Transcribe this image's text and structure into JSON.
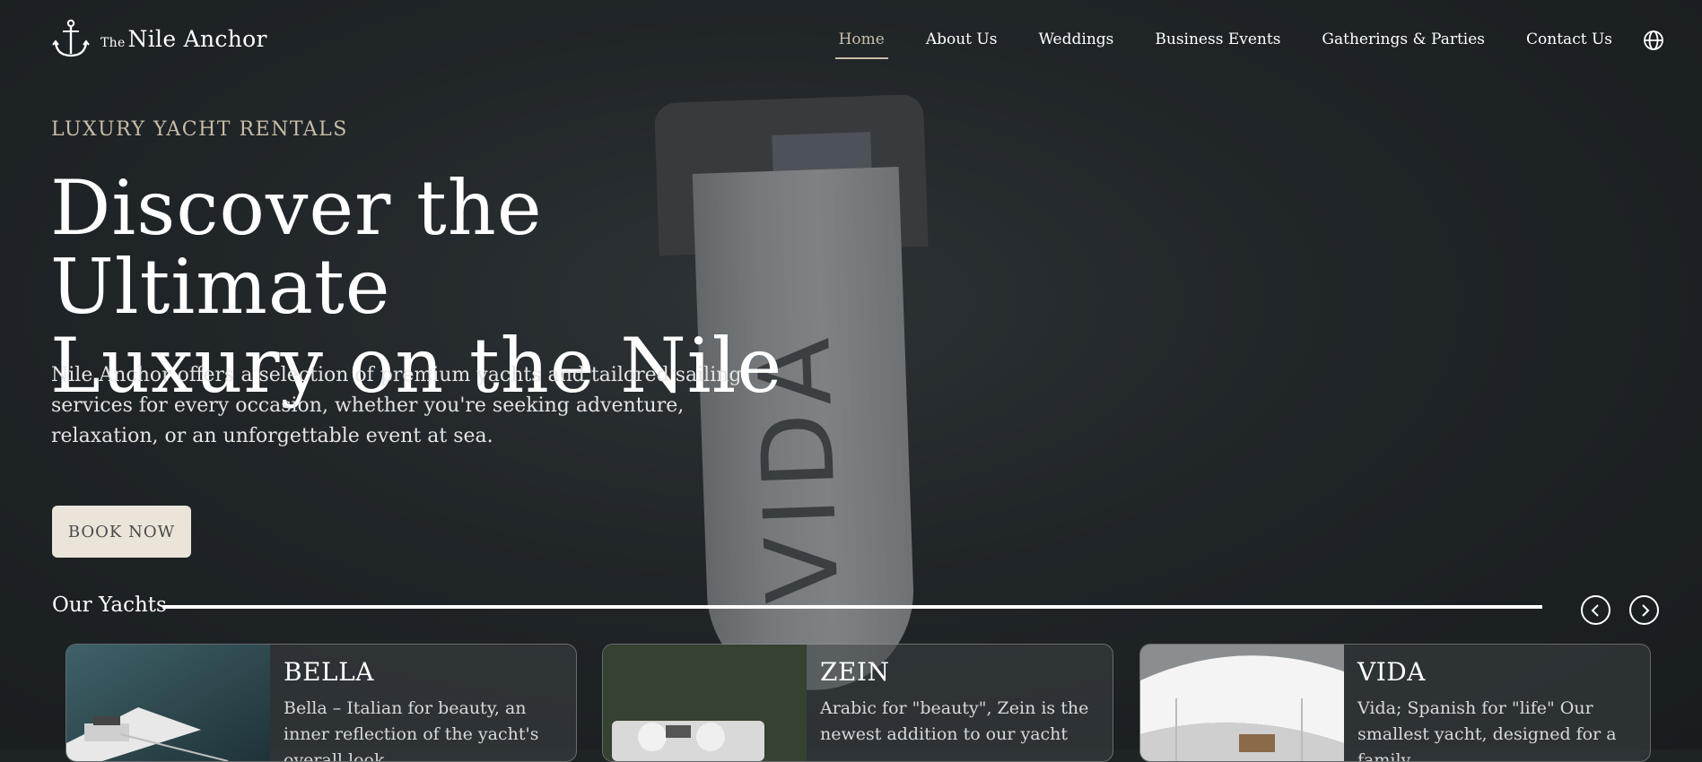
{
  "brand": {
    "prefix": "The",
    "name": "Nile Anchor",
    "accent": "#c8bca6"
  },
  "nav": {
    "items": [
      {
        "label": "Home",
        "active": true
      },
      {
        "label": "About Us"
      },
      {
        "label": "Weddings"
      },
      {
        "label": "Business Events"
      },
      {
        "label": "Gatherings & Parties"
      },
      {
        "label": "Contact Us"
      }
    ],
    "language_icon": "globe-icon"
  },
  "hero": {
    "eyebrow": "LUXURY YACHT RENTALS",
    "title_line1": "Discover the Ultimate",
    "title_line2": "Luxury on the Nile",
    "lead": "Nile Anchor offers a selection of premium yachts and tailored sailing services for every occasion, whether you're seeking adventure, relaxation, or an unforgettable event at sea.",
    "cta": "BOOK NOW",
    "image_text": "VIDA"
  },
  "yachts": {
    "heading": "Our Yachts",
    "prev_icon": "chevron-left-icon",
    "next_icon": "chevron-right-icon",
    "cards": [
      {
        "name": "BELLA",
        "desc": "Bella – Italian for beauty, an inner reflection of the yacht's overall look."
      },
      {
        "name": "ZEIN",
        "desc": "Arabic for \"beauty\", Zein is the newest addition to our yacht"
      },
      {
        "name": "VIDA",
        "desc": "Vida; Spanish for \"life\" Our smallest yacht, designed for a family"
      }
    ]
  }
}
